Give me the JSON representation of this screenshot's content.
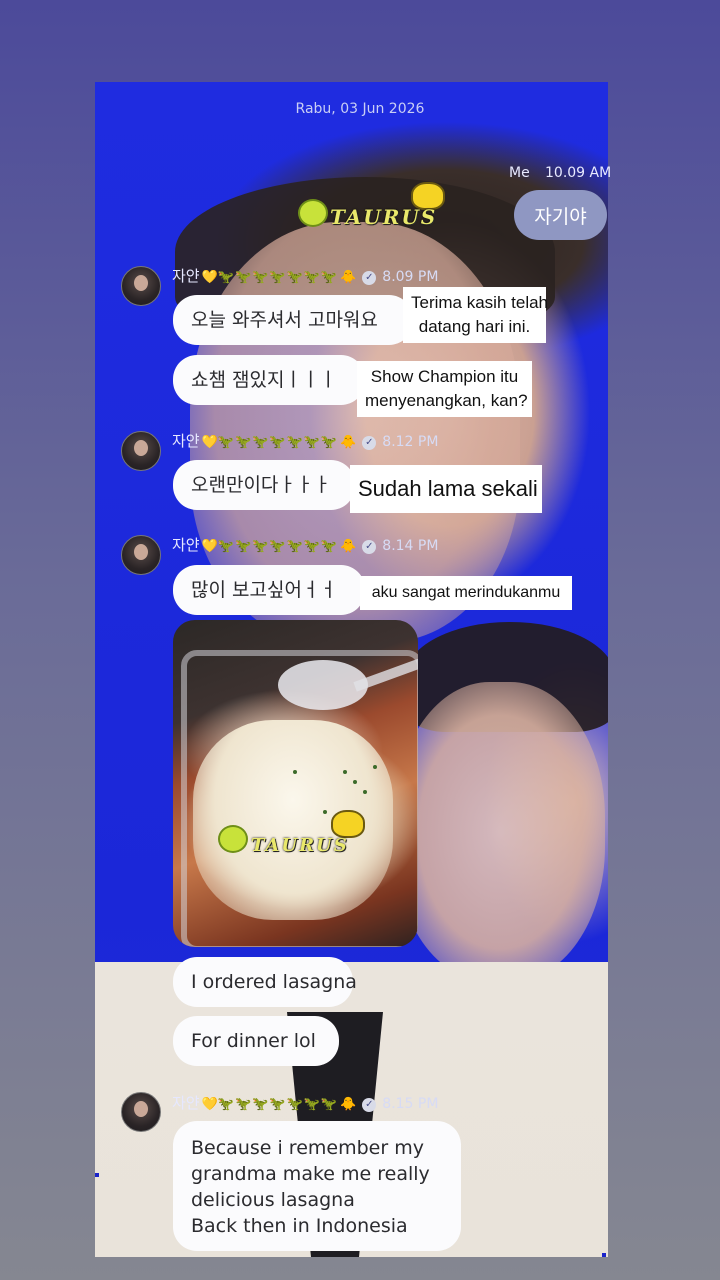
{
  "date_header": "Rabu, 03 Jun 2026",
  "me": {
    "label": "Me",
    "time": "10.09 AM",
    "message": "자기야"
  },
  "watermark": {
    "text": "TAURUS"
  },
  "sender": {
    "name": "자얀",
    "heart": "💛",
    "dinos": "🦖🦖🦖🦖🦖🦖🦖",
    "chick": "🐥",
    "check": "✓"
  },
  "groups": [
    {
      "time": "8.09 PM",
      "messages": [
        {
          "text": "오늘 와주셔서 고마워요",
          "translation": "Terima kasih telah datang hari ini."
        },
        {
          "text": "쇼챔 잼있지ㅣㅣㅣ",
          "translation": "Show Champion itu menyenangkan, kan?"
        }
      ]
    },
    {
      "time": "8.12 PM",
      "messages": [
        {
          "text": "오랜만이다ㅏㅏㅏ",
          "translation": "Sudah lama sekali"
        }
      ]
    },
    {
      "time": "8.14 PM",
      "messages": [
        {
          "text": "많이 보고싶어ㅓㅓ",
          "translation": "aku sangat merindukanmu"
        },
        {
          "text": "I ordered lasagna"
        },
        {
          "text": "For dinner lol"
        }
      ]
    },
    {
      "time": "8.15 PM",
      "messages": [
        {
          "lines": [
            "Because i remember my",
            "grandma make me really",
            "delicious lasagna",
            "Back then in Indonesia"
          ]
        }
      ]
    }
  ],
  "translations_split": {
    "g1m1": [
      "Terima kasih telah",
      "datang hari ini."
    ],
    "g1m2": [
      "Show Champion itu",
      "menyenangkan, kan?"
    ]
  }
}
